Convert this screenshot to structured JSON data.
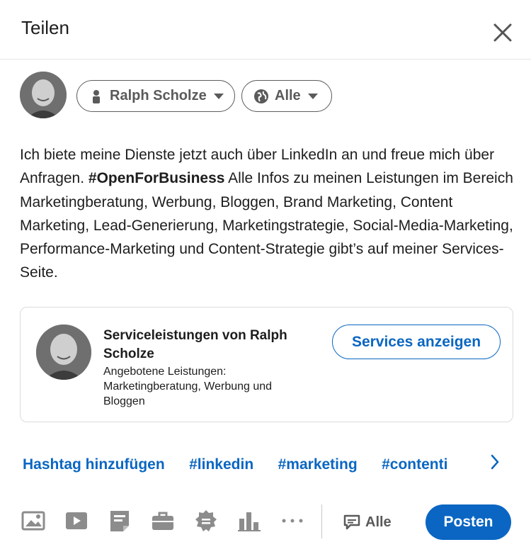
{
  "dialog": {
    "title": "Teilen"
  },
  "author": {
    "name": "Ralph Scholze"
  },
  "visibility": {
    "label": "Alle"
  },
  "post": {
    "text_part1": "Ich biete meine Dienste jetzt auch über LinkedIn an und freue mich über Anfragen. ",
    "hashtag": "#OpenForBusiness",
    "text_part2": " Alle Infos zu meinen Leistungen im Bereich Marketingberatung, Werbung, Bloggen, Brand Marketing, Content Marketing, Lead-Generierung, Marketingstrategie, Social-Media-Marketing, Performance-Marketing und Content-Strategie gibt’s auf meiner Services-Seite."
  },
  "service_card": {
    "title": "Serviceleistungen von Ralph Scholze",
    "description": "Angebotene Leistungen: Marketingberatung, Werbung und Bloggen",
    "button_label": "Services anzeigen"
  },
  "hashtags": {
    "add_label": "Hashtag hinzufügen",
    "suggestions": [
      "#linkedin",
      "#marketing",
      "#contenti"
    ]
  },
  "toolbar": {
    "icons": [
      "photo-icon",
      "video-icon",
      "document-icon",
      "job-icon",
      "celebrate-icon",
      "poll-icon",
      "more-icon"
    ],
    "comment_visibility": "Alle",
    "post_label": "Posten"
  },
  "colors": {
    "accent": "#0a66c2",
    "text": "#1d1d1d",
    "muted": "#5a5a5a"
  }
}
